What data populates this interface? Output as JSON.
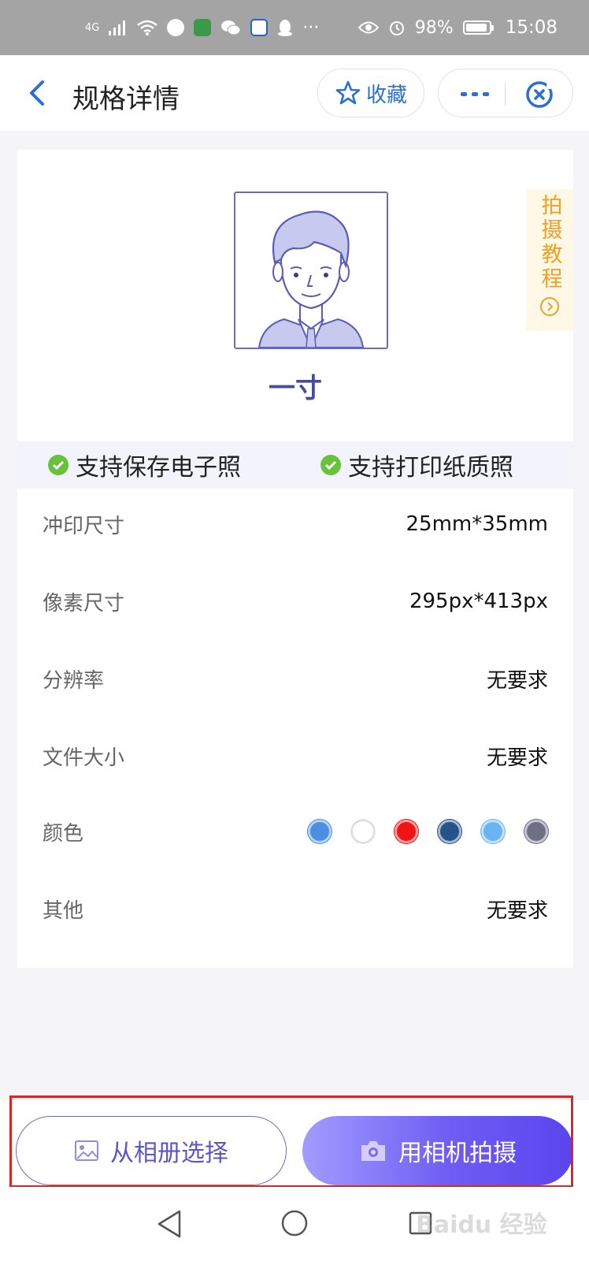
{
  "status_bar": {
    "network": "4G",
    "battery": "98%",
    "time": "15:08",
    "more": "···"
  },
  "header": {
    "title": "规格详情",
    "favorite_label": "收藏"
  },
  "spec": {
    "name": "一寸",
    "tutorial_label": "拍摄教程"
  },
  "support": [
    {
      "label": "支持保存电子照"
    },
    {
      "label": "支持打印纸质照"
    }
  ],
  "details": {
    "print_size": {
      "label": "冲印尺寸",
      "value": "25mm*35mm"
    },
    "pixel_size": {
      "label": "像素尺寸",
      "value": "295px*413px"
    },
    "resolution": {
      "label": "分辨率",
      "value": "无要求"
    },
    "file_size": {
      "label": "文件大小",
      "value": "无要求"
    },
    "color": {
      "label": "颜色"
    },
    "other": {
      "label": "其他",
      "value": "无要求"
    }
  },
  "colors": [
    "#4a8fe0",
    "#ffffff",
    "#f01414",
    "#24548a",
    "#6bb4f4",
    "#6c7082"
  ],
  "actions": {
    "album_label": "从相册选择",
    "camera_label": "用相机拍摄"
  },
  "watermark": "Baidu 经验"
}
